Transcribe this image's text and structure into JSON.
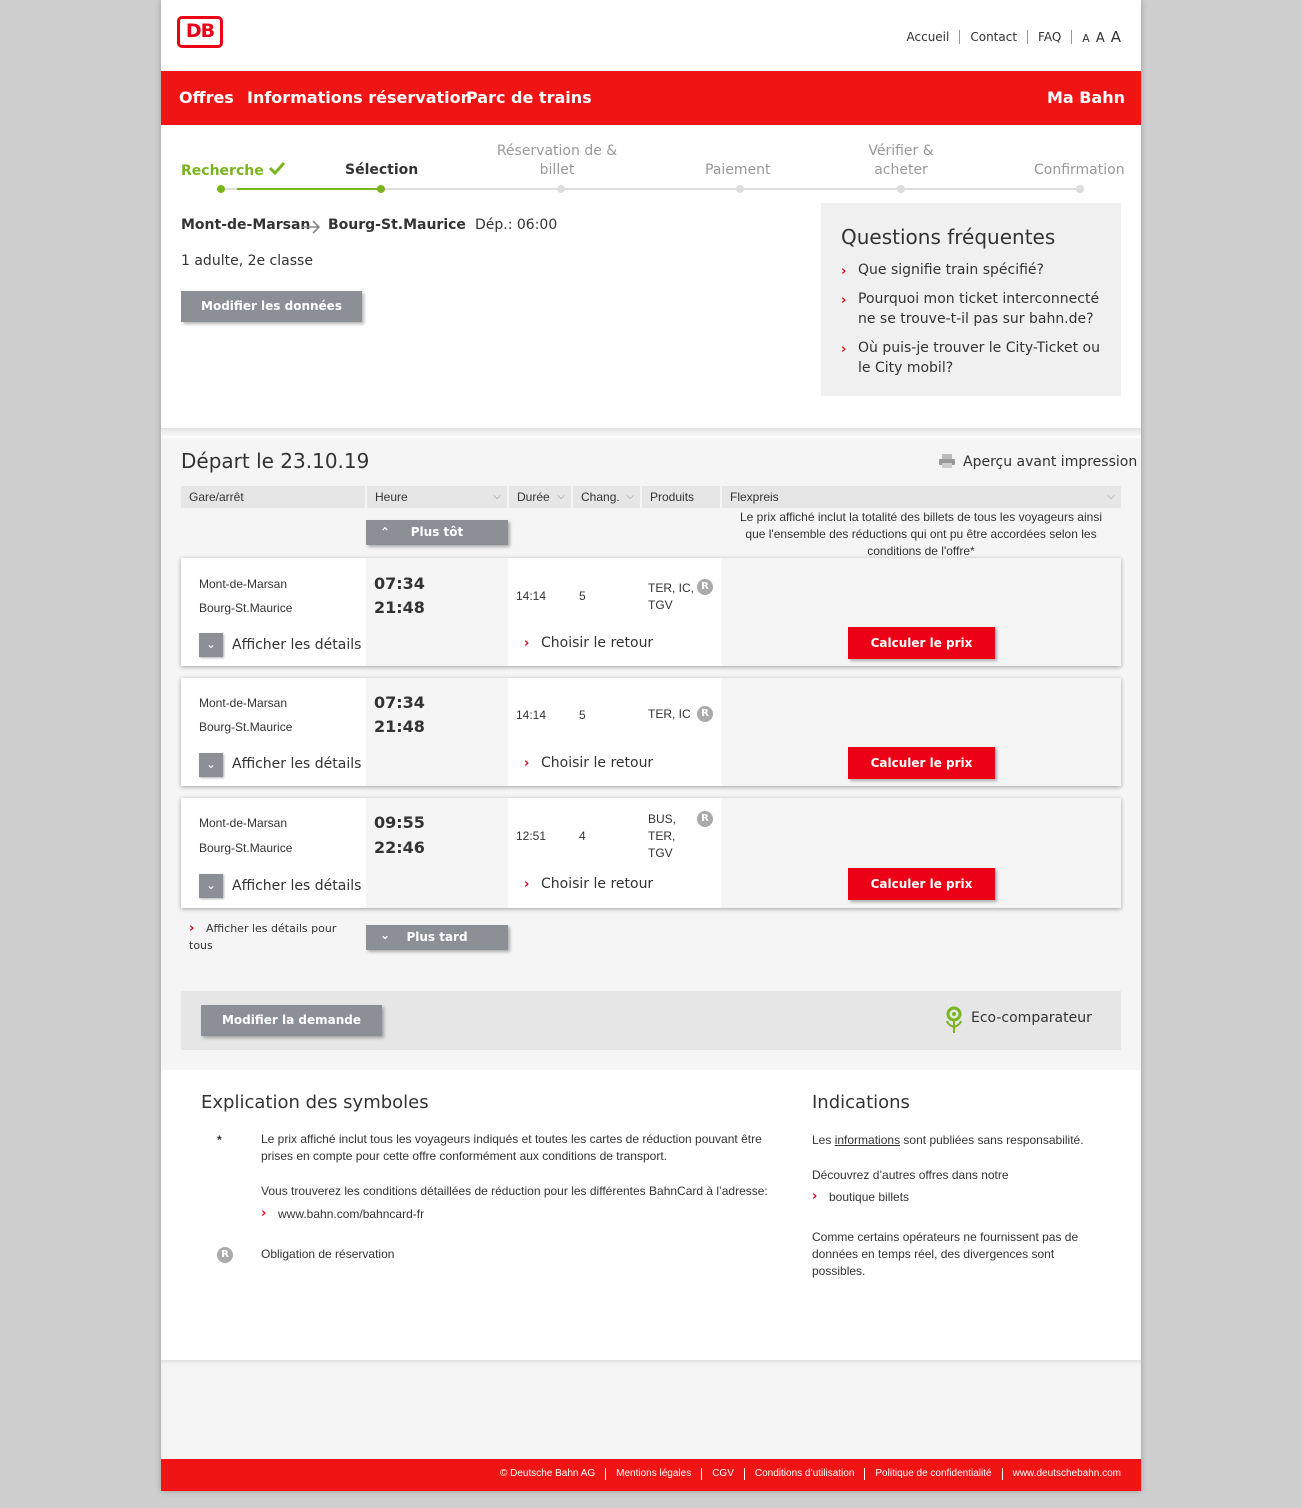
{
  "header": {
    "logo": "DB",
    "top_links": [
      "Accueil",
      "Contact",
      "FAQ"
    ],
    "font_sizes": [
      "A",
      "A",
      "A"
    ]
  },
  "nav": {
    "offres": "Offres",
    "info": "Informations réservation",
    "parc": "Parc de trains",
    "mabahn": "Ma Bahn"
  },
  "steps": {
    "s1": "Recherche",
    "s2": "Sélection",
    "s3a": "Réservation de &",
    "s3b": "billet",
    "s4": "Paiement",
    "s5a": "Vérifier &",
    "s5b": "acheter",
    "s6": "Confirmation"
  },
  "journey": {
    "from": "Mont-de-Marsan",
    "to": "Bourg-St.Maurice",
    "dep": "Dép.: 06:00",
    "pax": "1 adulte, 2e classe",
    "modify": "Modifier les données"
  },
  "faq": {
    "title": "Questions fréquentes",
    "q1": "Que signifie train spécifié?",
    "q2": "Pourquoi mon ticket interconnecté ne se trouve-t-il pas sur bahn.de?",
    "q3": "Où puis-je trouver le City-Ticket ou le City mobil?"
  },
  "results": {
    "title": "Départ le 23.10.19",
    "print": "Aperçu avant impression",
    "cols": {
      "station": "Gare/arrêt",
      "time": "Heure",
      "duration": "Durée",
      "changes": "Chang.",
      "products": "Produits",
      "price": "Flexpreis"
    },
    "earlier": "Plus tôt",
    "later": "Plus tard",
    "price_note": "Le prix affiché inclut la totalité des billets de tous les voyageurs ainsi que l'ensemble des réductions qui ont pu être accordées selon les conditions de l'offre*",
    "details_label": "Afficher les détails",
    "return_label": "Choisir le retour",
    "calc_label": "Calculer le prix",
    "reservation_badge": "R",
    "all_details": "Afficher les détails pour tous",
    "connections": [
      {
        "from": "Mont-de-Marsan",
        "to": "Bourg-St.Maurice",
        "dep": "07:34",
        "arr": "21:48",
        "duration": "14:14",
        "changes": "5",
        "products": "TER, IC, TGV"
      },
      {
        "from": "Mont-de-Marsan",
        "to": "Bourg-St.Maurice",
        "dep": "07:34",
        "arr": "21:48",
        "duration": "14:14",
        "changes": "5",
        "products": "TER, IC"
      },
      {
        "from": "Mont-de-Marsan",
        "to": "Bourg-St.Maurice",
        "dep": "09:55",
        "arr": "22:46",
        "duration": "12:51",
        "changes": "4",
        "products": "BUS, TER, TGV"
      }
    ],
    "modify_request": "Modifier la demande",
    "eco": "Eco-comparateur"
  },
  "legend": {
    "title": "Explication des symboles",
    "star": "*",
    "star_text": "Le prix affiché inclut tous les voyageurs indiqués et toutes les cartes de réduction pouvant être prises en compte pour cette offre conformément aux conditions de transport.",
    "bahncard_text": "Vous trouverez les conditions détaillées de réduction pour les différentes BahnCard à l’adresse:",
    "bahncard_link": "www.bahn.com/bahncard-fr",
    "r_badge": "R",
    "r_text": "Obligation de réservation"
  },
  "indications": {
    "title": "Indications",
    "p1_pre": "Les",
    "p1_link": "informations",
    "p1_post": "sont publiées sans responsabilité.",
    "p2": "Découvrez d’autres offres dans notre",
    "p2_link": "boutique billets",
    "p3": "Comme certains opérateurs ne fournissent pas de données en temps réel, des divergences sont possibles."
  },
  "footer": [
    "© Deutsche Bahn AG",
    "Mentions légales",
    "CGV",
    "Conditions d’utilisation",
    "Politique de confidentialité",
    "www.deutschebahn.com"
  ],
  "colors": {
    "accent": "#ec0016",
    "green": "#7ab51d",
    "grey_button": "#8b8f96"
  }
}
